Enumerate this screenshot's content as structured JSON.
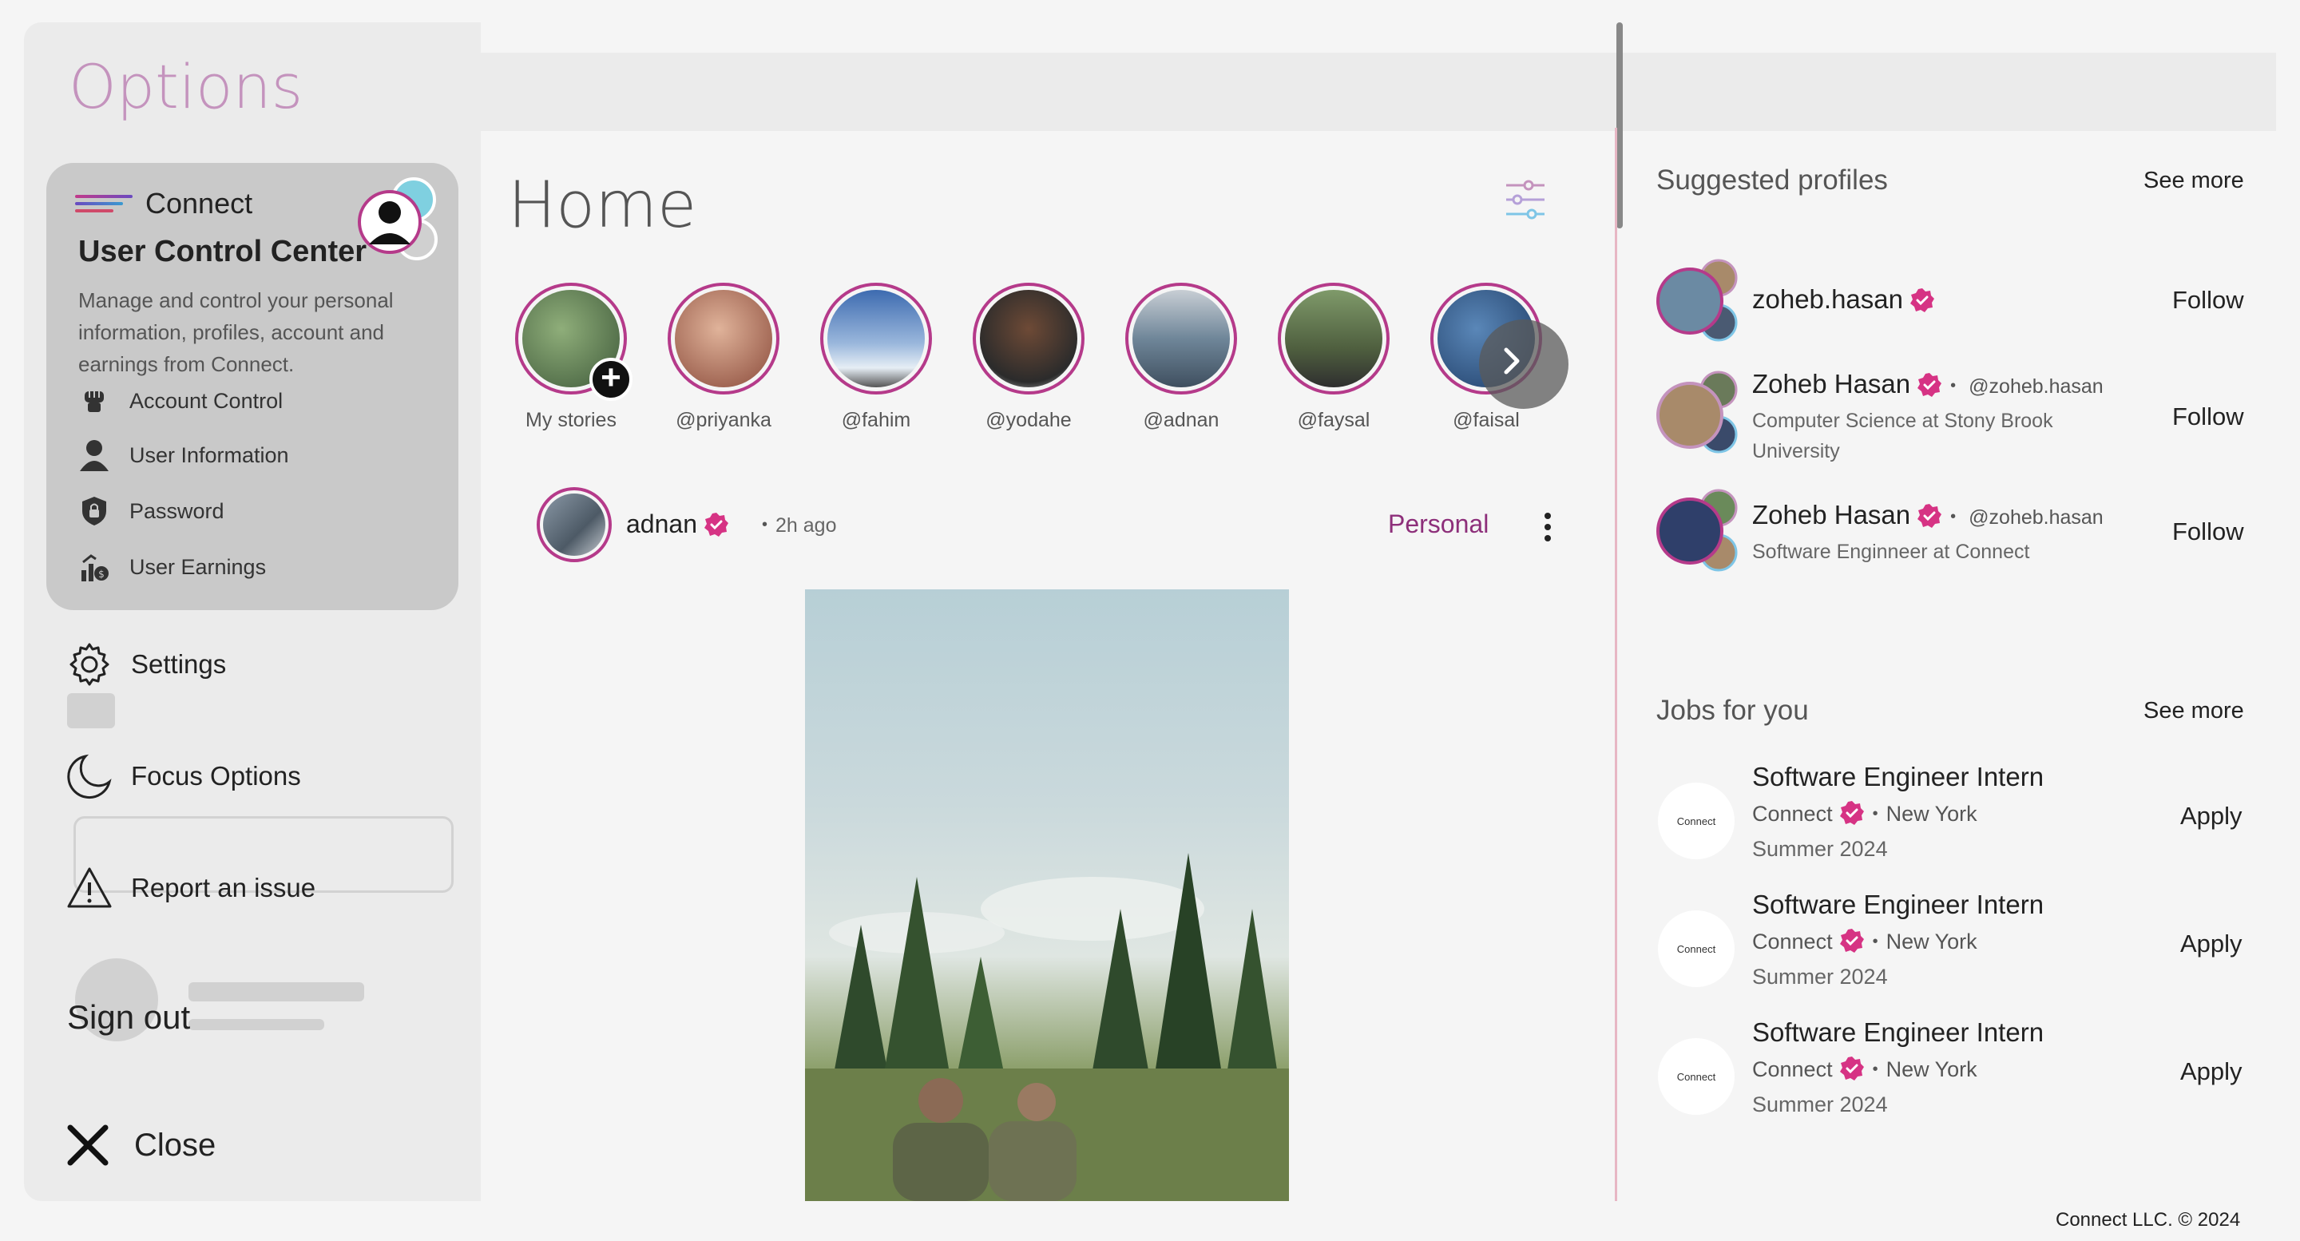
{
  "options": {
    "title": "Options",
    "control_center": {
      "brand": "Connect",
      "title": "User Control Center",
      "description": "Manage and control your personal information, profiles, account and earnings from Connect.",
      "items": [
        {
          "label": "Account Control",
          "icon": "fist-icon"
        },
        {
          "label": "User Information",
          "icon": "user-icon"
        },
        {
          "label": "Password",
          "icon": "lock-shield-icon"
        },
        {
          "label": "User Earnings",
          "icon": "earnings-icon"
        }
      ]
    },
    "links": [
      {
        "label": "Settings",
        "icon": "gear-icon"
      },
      {
        "label": "Focus Options",
        "icon": "moon-icon"
      },
      {
        "label": "Report an issue",
        "icon": "warning-icon"
      }
    ],
    "sign_out": "Sign out",
    "close": "Close"
  },
  "home": {
    "title": "Home",
    "stories": [
      {
        "name": "My stories",
        "color": "#5f7f55"
      },
      {
        "name": "@priyanka",
        "color": "#b0645a"
      },
      {
        "name": "@fahim",
        "color": "#4f6ea3"
      },
      {
        "name": "@yodahe",
        "color": "#6e5a4a"
      },
      {
        "name": "@adnan",
        "color": "#7a8a98"
      },
      {
        "name": "@faysal",
        "color": "#5b6b48"
      },
      {
        "name": "@faisal",
        "color": "#3c6fa6"
      }
    ],
    "post": {
      "user": "adnan",
      "time": "2h ago",
      "tag": "Personal"
    }
  },
  "suggested": {
    "title": "Suggested profiles",
    "see_more": "See more",
    "profiles": [
      {
        "name": "zoheb.hasan",
        "handle": "",
        "sub": "",
        "action": "Follow"
      },
      {
        "name": "Zoheb Hasan",
        "handle": "@zoheb.hasan",
        "sub": "Computer Science at Stony Brook University",
        "action": "Follow"
      },
      {
        "name": "Zoheb Hasan",
        "handle": "@zoheb.hasan",
        "sub": "Software Enginneer at Connect",
        "action": "Follow"
      }
    ]
  },
  "jobs": {
    "title": "Jobs for you",
    "see_more": "See more",
    "logo_text": "Connect",
    "items": [
      {
        "title": "Software Engineer Intern",
        "company": "Connect",
        "location": "New York",
        "season": "Summer 2024",
        "action": "Apply"
      },
      {
        "title": "Software Engineer Intern",
        "company": "Connect",
        "location": "New York",
        "season": "Summer 2024",
        "action": "Apply"
      },
      {
        "title": "Software Engineer Intern",
        "company": "Connect",
        "location": "New York",
        "season": "Summer 2024",
        "action": "Apply"
      }
    ]
  },
  "footer": "Connect LLC. © 2024",
  "colors": {
    "accent": "#b53a8a",
    "verified": "#d63384",
    "options_title": "#c493bd"
  }
}
